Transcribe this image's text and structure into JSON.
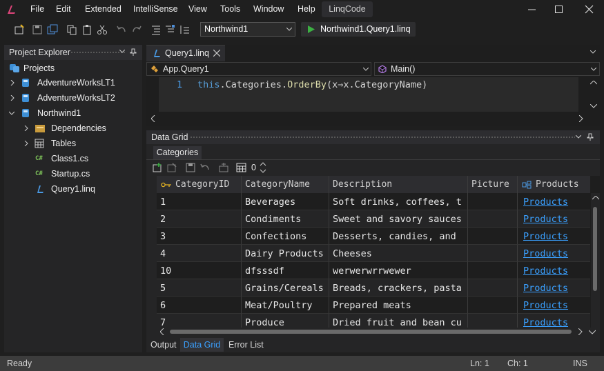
{
  "menu": [
    "File",
    "Edit",
    "Extended",
    "IntelliSense",
    "View",
    "Tools",
    "Window",
    "Help"
  ],
  "app_name": "LinqCode",
  "toolbar": {
    "database": "Northwind1",
    "run_label": "Northwind1.Query1.linq"
  },
  "explorer": {
    "title": "Project Explorer",
    "items": [
      {
        "label": "Projects"
      },
      {
        "label": "AdventureWorksLT1"
      },
      {
        "label": "AdventureWorksLT2"
      },
      {
        "label": "Northwind1"
      },
      {
        "label": "Dependencies"
      },
      {
        "label": "Tables"
      },
      {
        "label": "Class1.cs"
      },
      {
        "label": "Startup.cs"
      },
      {
        "label": "Query1.linq"
      }
    ]
  },
  "editor": {
    "tab": "Query1.linq",
    "nav_left": "App.Query1",
    "nav_right": "Main()",
    "line_number": "1",
    "code": {
      "kw": "this",
      "rest1": ".Categories.",
      "method": "OrderBy",
      "rest2": "(x⇒x.CategoryName)"
    }
  },
  "grid": {
    "panel_title": "Data Grid",
    "subtab": "Categories",
    "count": "0",
    "columns": [
      "CategoryID",
      "CategoryName",
      "Description",
      "Picture",
      "Products"
    ],
    "rows": [
      [
        "1",
        "Beverages",
        "Soft drinks, coffees, t",
        "",
        "Products"
      ],
      [
        "2",
        "Condiments",
        "Sweet and savory sauces",
        "",
        "Products"
      ],
      [
        "3",
        "Confections",
        "Desserts, candies, and",
        "",
        "Products"
      ],
      [
        "4",
        "Dairy Products",
        "Cheeses",
        "",
        "Products"
      ],
      [
        "10",
        "dfsssdf",
        "werwerwrrwewer",
        "",
        "Products"
      ],
      [
        "5",
        "Grains/Cereals",
        "Breads, crackers, pasta",
        "",
        "Products"
      ],
      [
        "6",
        "Meat/Poultry",
        "Prepared meats",
        "",
        "Products"
      ],
      [
        "7",
        "Produce",
        "Dried fruit and bean cu",
        "",
        "Products"
      ]
    ]
  },
  "bottom_tabs": [
    "Output",
    "Data Grid",
    "Error List"
  ],
  "status": {
    "left": "Ready",
    "line": "Ln: 1",
    "col": "Ch: 1",
    "mode": "INS"
  },
  "colors": {
    "accent": "#3aa0ff",
    "run_green": "#3cb043",
    "link": "#3aa0ff"
  }
}
